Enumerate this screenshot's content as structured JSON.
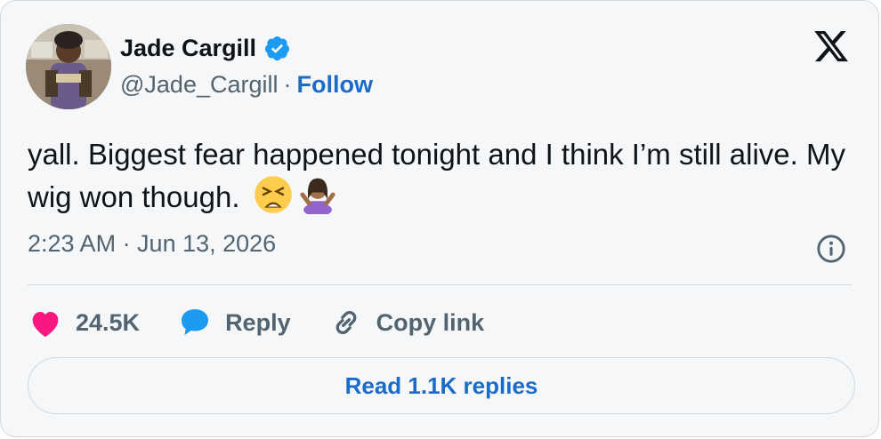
{
  "author": {
    "name": "Jade Cargill",
    "handle": "@Jade_Cargill",
    "follow_label": "Follow",
    "separator": "·",
    "verified": true
  },
  "tweet": {
    "text": "yall. Biggest fear happened tonight and I think I’m still alive. My wig won though.",
    "emojis": [
      "weary-face",
      "person-shrugging"
    ],
    "timestamp": "2:23 AM · Jun 13, 2026"
  },
  "actions": {
    "likes_count": "24.5K",
    "reply_label": "Reply",
    "copy_label": "Copy link"
  },
  "read_replies_label": "Read 1.1K replies",
  "colors": {
    "accent": "#1a6ccb",
    "heart": "#f91880",
    "reply_bubble": "#1d9bf0",
    "secondary_text": "#536471",
    "verified": "#1d9bf0"
  },
  "icons": [
    "x-logo-icon",
    "verified-badge-icon",
    "info-icon",
    "heart-icon",
    "reply-icon",
    "link-icon"
  ]
}
